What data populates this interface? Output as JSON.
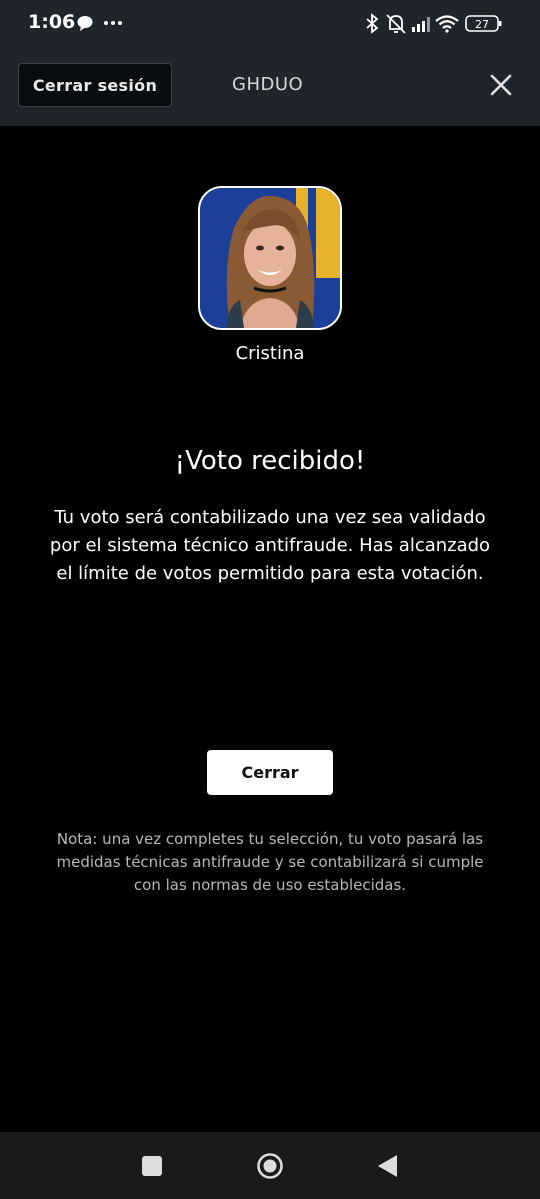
{
  "status_bar": {
    "time": "1:06",
    "battery": "27",
    "left_icons": [
      "chat-bubble-icon",
      "more-dots-icon"
    ],
    "right_icons": [
      "bluetooth-icon",
      "muted-bell-icon",
      "signal-icon",
      "wifi-icon",
      "battery-icon"
    ]
  },
  "header": {
    "logout_label": "Cerrar sesión",
    "brand": "GHDUO"
  },
  "contestant": {
    "name": "Cristina"
  },
  "result": {
    "title": "¡Voto recibido!",
    "message": "Tu voto será contabilizado una vez sea validado por el sistema técnico antifraude. Has alcanzado el límite de votos permitido para esta votación."
  },
  "actions": {
    "close_label": "Cerrar"
  },
  "note": "Nota: una vez completes tu selección, tu voto pasará las medidas técnicas antifraude y se contabilizará si cumple con las normas de uso establecidas.",
  "colors": {
    "header_bg": "#1f252b",
    "page_bg": "#000000",
    "button_bg": "#ffffff",
    "note_text": "#b8b8b8"
  }
}
